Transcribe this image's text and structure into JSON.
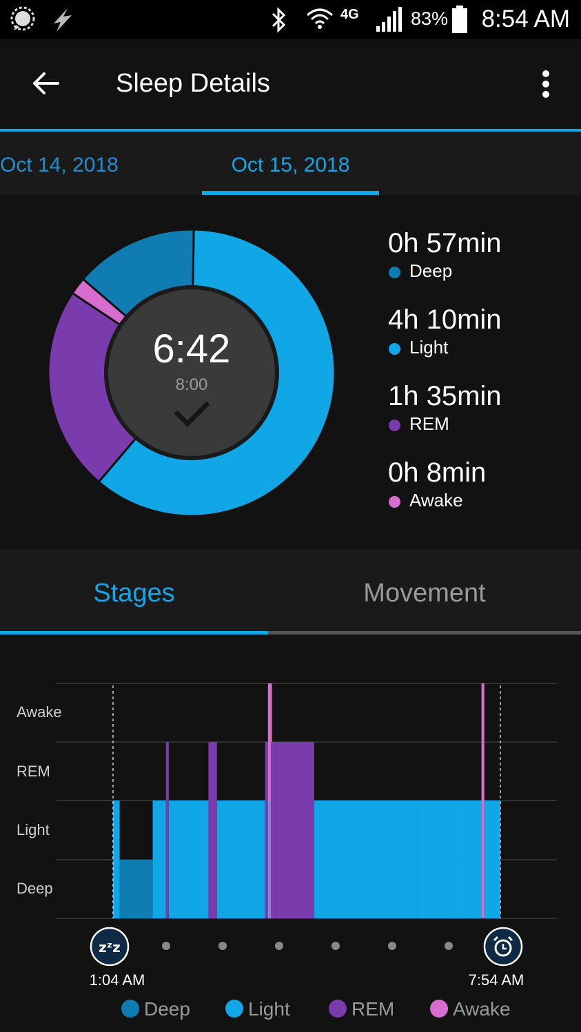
{
  "status_bar": {
    "time": "8:54 AM",
    "battery_percent": "83%",
    "network": "4G",
    "icons": [
      "signal-messenger-icon",
      "flash-icon",
      "bluetooth-icon",
      "wifi-icon",
      "lte-icon",
      "cell-signal-icon",
      "battery-icon"
    ]
  },
  "app_bar": {
    "title": "Sleep Details",
    "back_icon": "arrow-left-icon",
    "menu_icon": "more-vertical-icon"
  },
  "date_tabs": [
    {
      "label": "Oct 14, 2018",
      "selected": false
    },
    {
      "label": "Oct 15, 2018",
      "selected": true
    }
  ],
  "summary": {
    "total": "6:42",
    "goal": "8:00",
    "goal_met_icon": "checkmark-icon",
    "stages": [
      {
        "duration": "0h 57min",
        "label": "Deep",
        "minutes": 57,
        "color": "#0f7db2"
      },
      {
        "duration": "4h 10min",
        "label": "Light",
        "minutes": 250,
        "color": "#11a6e6"
      },
      {
        "duration": "1h 35min",
        "label": "REM",
        "minutes": 95,
        "color": "#7a3cac"
      },
      {
        "duration": "0h 8min",
        "label": "Awake",
        "minutes": 8,
        "color": "#d86dd0"
      }
    ]
  },
  "stage_tabs": [
    {
      "label": "Stages",
      "selected": true
    },
    {
      "label": "Movement",
      "selected": false
    }
  ],
  "chart_data": {
    "type": "area",
    "y_categories": [
      "Deep",
      "Light",
      "REM",
      "Awake"
    ],
    "start_time": "1:04 AM",
    "end_time": "7:54 AM",
    "start_icon": "zzz-sleep-icon",
    "end_icon": "alarm-clock-icon",
    "segments": [
      {
        "stage": "Light",
        "start": "1:04",
        "end": "1:11"
      },
      {
        "stage": "Deep",
        "start": "1:11",
        "end": "1:46"
      },
      {
        "stage": "Light",
        "start": "1:46",
        "end": "2:00"
      },
      {
        "stage": "REM",
        "start": "2:00",
        "end": "2:03"
      },
      {
        "stage": "Light",
        "start": "2:03",
        "end": "2:45"
      },
      {
        "stage": "REM",
        "start": "2:45",
        "end": "2:54"
      },
      {
        "stage": "Light",
        "start": "2:54",
        "end": "3:45"
      },
      {
        "stage": "REM",
        "start": "3:45",
        "end": "3:48"
      },
      {
        "stage": "Awake",
        "start": "3:48",
        "end": "3:49"
      },
      {
        "stage": "Light",
        "start": "3:49",
        "end": "3:50"
      },
      {
        "stage": "Awake",
        "start": "3:50",
        "end": "3:51"
      },
      {
        "stage": "REM",
        "start": "3:51",
        "end": "3:56"
      },
      {
        "stage": "REM",
        "start": "3:56",
        "end": "4:37"
      },
      {
        "stage": "Light",
        "start": "4:37",
        "end": "6:27"
      },
      {
        "stage": "Light",
        "start": "6:27",
        "end": "7:04"
      },
      {
        "stage": "Light",
        "start": "7:04",
        "end": "7:34"
      },
      {
        "stage": "Awake",
        "start": "7:34",
        "end": "7:37"
      },
      {
        "stage": "Light",
        "start": "7:37",
        "end": "7:54"
      }
    ],
    "legend": [
      {
        "label": "Deep",
        "color": "#0f7db2"
      },
      {
        "label": "Light",
        "color": "#11a6e6"
      },
      {
        "label": "REM",
        "color": "#7a3cac"
      },
      {
        "label": "Awake",
        "color": "#d86dd0"
      }
    ],
    "grid": true
  }
}
